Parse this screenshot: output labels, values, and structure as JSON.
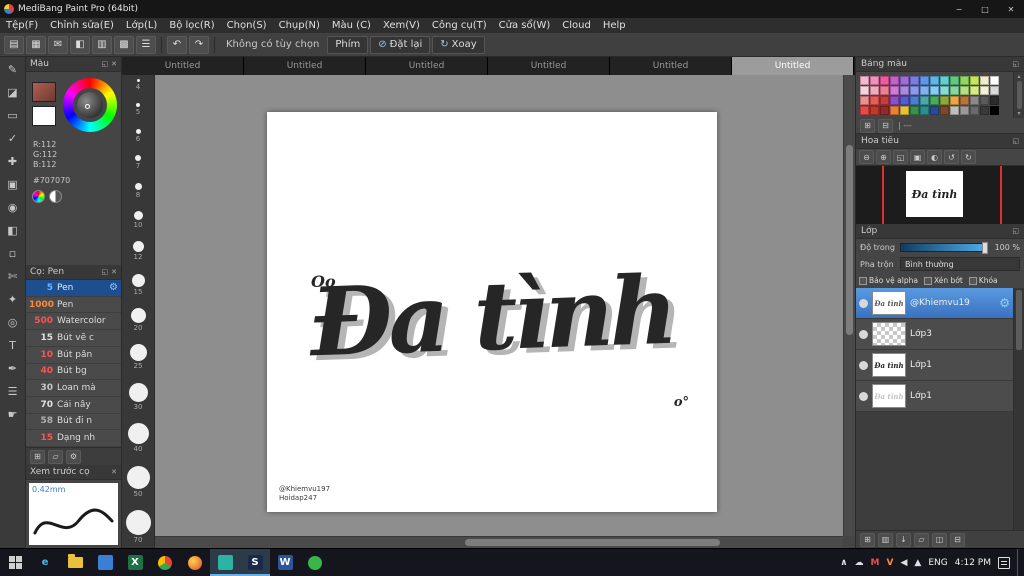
{
  "window": {
    "title": "MediBang Paint Pro (64bit)"
  },
  "ui": {
    "close_glyph": "✕",
    "popout_glyph": "◱",
    "gear_glyph": "⚙",
    "min_glyph": "−",
    "max_glyph": "□",
    "scroll_up_glyph": "▴",
    "scroll_down_glyph": "▾"
  },
  "menu": {
    "items": [
      "Tệp(F)",
      "Chỉnh sửa(E)",
      "Lớp(L)",
      "Bộ lọc(R)",
      "Chọn(S)",
      "Chụp(N)",
      "Màu (C)",
      "Xem(V)",
      "Công cụ(T)",
      "Cửa sổ(W)",
      "Cloud",
      "Help"
    ]
  },
  "toolbar": {
    "icons": [
      {
        "name": "new-file-icon",
        "glyph": "▤"
      },
      {
        "name": "save-icon",
        "glyph": "▦"
      },
      {
        "name": "message-icon",
        "glyph": "✉"
      },
      {
        "name": "palette-icon",
        "glyph": "◧"
      },
      {
        "name": "document-icon",
        "glyph": "▥"
      },
      {
        "name": "grid-icon",
        "glyph": "▩"
      },
      {
        "name": "material-panel-icon",
        "glyph": "☰"
      }
    ],
    "undo_glyph": "↶",
    "redo_glyph": "↷",
    "no_option_label": "Không có tùy chọn",
    "key_button": "Phím",
    "reset_icon": "⊘",
    "reset_button": "Đặt lại",
    "rotate_icon": "↻",
    "rotate_button": "Xoay"
  },
  "tabs": {
    "labels": [
      "Untitled",
      "Untitled",
      "Untitled",
      "Untitled",
      "Untitled",
      "Untitled"
    ],
    "active_index": 5
  },
  "tools": [
    {
      "name": "pen-tool",
      "glyph": "✎"
    },
    {
      "name": "eraser-tool",
      "glyph": "◪"
    },
    {
      "name": "marquee-tool",
      "glyph": "▭"
    },
    {
      "name": "select-pen-tool",
      "glyph": "✓"
    },
    {
      "name": "move-tool",
      "glyph": "✚"
    },
    {
      "name": "transform-tool",
      "glyph": "▣"
    },
    {
      "name": "bucket-tool",
      "glyph": "◉"
    },
    {
      "name": "gradient-tool",
      "glyph": "◧"
    },
    {
      "name": "select-area-tool",
      "glyph": "▫"
    },
    {
      "name": "lasso-tool",
      "glyph": "✄"
    },
    {
      "name": "wand-tool",
      "glyph": "✦"
    },
    {
      "name": "shape-tool",
      "glyph": "◎"
    },
    {
      "name": "text-tool",
      "glyph": "T"
    },
    {
      "name": "eyedropper-tool",
      "glyph": "✒"
    },
    {
      "name": "panel-switch-tool",
      "glyph": "☰"
    },
    {
      "name": "hand-tool",
      "glyph": "☛"
    }
  ],
  "color_panel": {
    "title": "Màu",
    "r_label": "R:112",
    "g_label": "G:112",
    "b_label": "B:112",
    "hex_label": "#707070"
  },
  "brush_panel": {
    "title": "Cọ: Pen",
    "brushes": [
      {
        "size": "5",
        "name": "Pen",
        "color": "#6db3ff",
        "selected": true
      },
      {
        "size": "1000",
        "name": "Pen",
        "color": "#ff8a3c",
        "selected": false
      },
      {
        "size": "500",
        "name": "Watercolor",
        "color": "#ff5252",
        "selected": false
      },
      {
        "size": "15",
        "name": "Bút vẽ c",
        "color": "#e0e0e0",
        "selected": false
      },
      {
        "size": "10",
        "name": "Bút pần",
        "color": "#ff5252",
        "selected": false
      },
      {
        "size": "40",
        "name": "Bút bg",
        "color": "#ff5252",
        "selected": false
      },
      {
        "size": "30",
        "name": "Loan mà",
        "color": "#c8c8c8",
        "selected": false
      },
      {
        "size": "70",
        "name": "Cải nầy",
        "color": "#e0e0e0",
        "selected": false
      },
      {
        "size": "58",
        "name": "Bút đi n",
        "color": "#b0b0b0",
        "selected": false
      },
      {
        "size": "15",
        "name": "Dạng nh",
        "color": "#ff5252",
        "selected": false
      }
    ],
    "footer_icons": [
      {
        "name": "add-brush-icon",
        "glyph": "⊞"
      },
      {
        "name": "brush-folder-icon",
        "glyph": "▱"
      },
      {
        "name": "brush-settings-icon",
        "glyph": "⚙"
      }
    ]
  },
  "preview_panel": {
    "title": "Xem trước cọ",
    "size_label": "0.42mm"
  },
  "sizes": [
    {
      "label": "4",
      "d": 3
    },
    {
      "label": "5",
      "d": 4
    },
    {
      "label": "6",
      "d": 5
    },
    {
      "label": "7",
      "d": 6
    },
    {
      "label": "8",
      "d": 7
    },
    {
      "label": "10",
      "d": 9
    },
    {
      "label": "12",
      "d": 11
    },
    {
      "label": "15",
      "d": 13
    },
    {
      "label": "20",
      "d": 15
    },
    {
      "label": "25",
      "d": 17
    },
    {
      "label": "30",
      "d": 19
    },
    {
      "label": "40",
      "d": 21
    },
    {
      "label": "50",
      "d": 23
    },
    {
      "label": "70",
      "d": 25
    }
  ],
  "canvas": {
    "artwork_text": "Đa tình",
    "deco_top": "Oo",
    "deco_bottom": "o°",
    "credit_line1": "@Khiemvu197",
    "credit_line2": "Hoidap247"
  },
  "palette_panel": {
    "title": "Bảng màu",
    "colors": [
      "#f7b7d0",
      "#f48fb9",
      "#ef5a9e",
      "#c162c9",
      "#9a6fd6",
      "#7b7de3",
      "#5e97e8",
      "#5fb6ea",
      "#63d0cf",
      "#5fc984",
      "#8fd75f",
      "#c6e55e",
      "#f2eccf",
      "#ffffff",
      "#f9d2df",
      "#f6a8c0",
      "#ef7f95",
      "#d07ad6",
      "#a98ae0",
      "#8a9aec",
      "#7fb3ef",
      "#84ccf1",
      "#86ddd8",
      "#84d89e",
      "#b1e284",
      "#d8ec86",
      "#f6f1dc",
      "#d9d9d9",
      "#ef8f8f",
      "#e85b5b",
      "#c83c3c",
      "#8f4ec2",
      "#5a5ad0",
      "#4a7fd0",
      "#4aa8a8",
      "#4aa85f",
      "#8fa83c",
      "#e8a84a",
      "#b5763c",
      "#8a8a8a",
      "#5a5a5a",
      "#2b2b2b",
      "#e84a4a",
      "#c0392b",
      "#8f2b2b",
      "#e8813a",
      "#e8c23a",
      "#3a8f4a",
      "#2b8f8f",
      "#2b4a8f",
      "#7a4a2b",
      "#bfbfbf",
      "#9a9a9a",
      "#6a6a6a",
      "#3a3a3a",
      "#000000"
    ],
    "footer_icons": [
      {
        "name": "add-color-icon",
        "glyph": "⊞"
      },
      {
        "name": "delete-color-icon",
        "glyph": "⊟"
      }
    ],
    "footer_label": "| ---"
  },
  "navigator": {
    "title": "Hoa tiêu",
    "icons": [
      {
        "name": "zoom-out-icon",
        "glyph": "⊖"
      },
      {
        "name": "zoom-in-icon",
        "glyph": "⊕"
      },
      {
        "name": "fit-screen-icon",
        "glyph": "◱"
      },
      {
        "name": "actual-size-icon",
        "glyph": "▣"
      },
      {
        "name": "flip-view-icon",
        "glyph": "◐"
      },
      {
        "name": "rotate-ccw-icon",
        "glyph": "↺"
      },
      {
        "name": "rotate-cw-icon",
        "glyph": "↻"
      }
    ],
    "preview_text": "Đa tình"
  },
  "layers_panel": {
    "title": "Lớp",
    "opacity_label": "Độ trong",
    "opacity_value": "100 %",
    "blend_label": "Pha trộn",
    "blend_value": "Bình thường",
    "checkboxes": [
      "Bảo vệ alpha",
      "Xén bớt",
      "Khóa"
    ],
    "layers": [
      {
        "name": "@Khiemvu19",
        "selected": true,
        "thumb": "art",
        "gear": true
      },
      {
        "name": "Lớp3",
        "selected": false,
        "thumb": "checker",
        "gear": false
      },
      {
        "name": "Lớp1",
        "selected": false,
        "thumb": "text",
        "gear": false
      },
      {
        "name": "Lớp1",
        "selected": false,
        "thumb": "faint",
        "gear": false
      }
    ],
    "footer_icons": [
      {
        "name": "new-layer-icon",
        "glyph": "⊞"
      },
      {
        "name": "duplicate-layer-icon",
        "glyph": "▥"
      },
      {
        "name": "merge-down-icon",
        "glyph": "↓"
      },
      {
        "name": "layer-folder-icon",
        "glyph": "▱"
      },
      {
        "name": "layer-camera-icon",
        "glyph": "◫"
      },
      {
        "name": "delete-layer-icon",
        "glyph": "⊟"
      }
    ]
  },
  "taskbar": {
    "apps": [
      {
        "name": "start-button",
        "kind": "start",
        "active": false
      },
      {
        "name": "taskbar-edge",
        "kind": "letter",
        "label": "e",
        "bg": "transparent",
        "fg": "#55b4f0",
        "active": false
      },
      {
        "name": "taskbar-file-explorer",
        "kind": "folder",
        "active": false
      },
      {
        "name": "taskbar-photos",
        "kind": "letter",
        "label": "",
        "bg": "#3b7fd4",
        "fg": "#ffffff",
        "active": false
      },
      {
        "name": "taskbar-excel",
        "kind": "letter",
        "label": "X",
        "bg": "#1e7145",
        "fg": "#ffffff",
        "active": false
      },
      {
        "name": "taskbar-chrome",
        "kind": "circle",
        "bg": "conic-gradient(#ea4335 0 120deg, #34a853 0 240deg, #fbbc05 0)",
        "active": false
      },
      {
        "name": "taskbar-firefox",
        "kind": "circle",
        "bg": "radial-gradient(circle at 35% 35%, #ffd54a, #e8703a 70%)",
        "active": false
      },
      {
        "name": "taskbar-medibang",
        "kind": "letter",
        "label": "",
        "bg": "#2bb3a3",
        "fg": "#ffffff",
        "active": true
      },
      {
        "name": "taskbar-paint-s",
        "kind": "letter",
        "label": "S",
        "bg": "#1b2a4a",
        "fg": "#ffffff",
        "active": true
      },
      {
        "name": "taskbar-word",
        "kind": "letter",
        "label": "W",
        "bg": "#2b579a",
        "fg": "#ffffff",
        "active": false
      },
      {
        "name": "taskbar-app-green",
        "kind": "circle",
        "bg": "#3ab54a",
        "active": false
      }
    ],
    "tray": [
      {
        "name": "tray-expand-icon",
        "glyph": "∧",
        "color": "#e0e0e0"
      },
      {
        "name": "tray-cloud-icon",
        "glyph": "☁",
        "color": "#e0e0e0"
      },
      {
        "name": "tray-antivirus-icon",
        "glyph": "M",
        "color": "#e85050"
      },
      {
        "name": "tray-media-icon",
        "glyph": "V",
        "color": "#ff8a3c"
      },
      {
        "name": "tray-volume-icon",
        "glyph": "◀",
        "color": "#e0e0e0"
      },
      {
        "name": "tray-network-icon",
        "glyph": "▲",
        "color": "#e0e0e0"
      }
    ],
    "lang": "ENG",
    "time": "4:12 PM"
  }
}
